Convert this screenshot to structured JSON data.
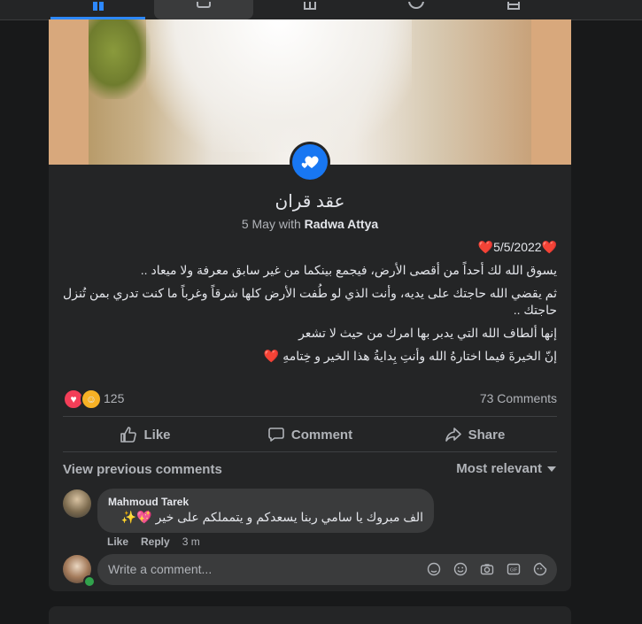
{
  "nav": {
    "tabs": [
      {
        "name": "home",
        "active": true
      },
      {
        "name": "watch",
        "active": false
      },
      {
        "name": "marketplace",
        "active": false
      },
      {
        "name": "groups",
        "active": false
      },
      {
        "name": "gaming",
        "active": false
      }
    ],
    "accent": "#2d88ff"
  },
  "post": {
    "life_event_icon": "hearts-icon",
    "event_title": "عقد قران",
    "event_date_prefix": "5 May with",
    "event_with_name": "Radwa Attya",
    "lines": [
      "❤️5/5/2022❤️",
      "يسوق الله لك أحداً من أقصى الأرض، فيجمع بينكما من غير سابق معرفة ولا ميعاد ..",
      "ثم يقضي الله حاجتك على يديه، وأنت الذي لو طُفت الأرض كلها شرقاً وغرباً ما كنت تدري بمن تُنزل حاجتك ..",
      "إنها ألطاف الله التي يدبر بها امرك من حيث لا تشعر",
      "إنّ الخيرةَ فيما اختارهُ الله وأنتِ بِدايةُ هذا الخير و خِتامهِ ❤️"
    ],
    "reactions": {
      "icons": [
        "love-icon",
        "care-icon"
      ],
      "count": "125"
    },
    "comments_count": "73 Comments",
    "actions": {
      "like": "Like",
      "comment": "Comment",
      "share": "Share"
    },
    "view_previous": "View previous comments",
    "sort_label": "Most relevant",
    "comment": {
      "author": "Mahmoud Tarek",
      "text": "الف مبروك يا سامي ربنا يسعدكم و يتمملكم على خير 💖✨",
      "like": "Like",
      "reply": "Reply",
      "time": "3 m"
    },
    "composer": {
      "placeholder": "Write a comment..."
    }
  }
}
